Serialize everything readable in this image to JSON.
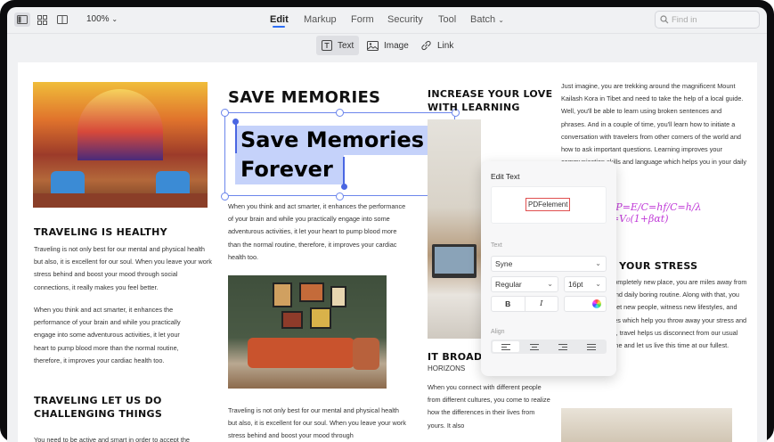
{
  "toolbar": {
    "zoom": "100%",
    "menus": [
      "Edit",
      "Markup",
      "Form",
      "Security",
      "Tool",
      "Batch"
    ],
    "search_placeholder": "Find in"
  },
  "subtoolbar": {
    "text": "Text",
    "image": "Image",
    "link": "Link"
  },
  "document": {
    "col1": {
      "h_travel": "TRAVELING IS HEALTHY",
      "p1": "Traveling is not only best for our mental and physical health but also, it is excellent for our soul. When you leave your work stress behind and boost your mood through social connections, it really makes you feel better.",
      "p2": "When you think and act smarter, it enhances the performance of your brain and while you practically engage into some adventurous activities, it let your heart to pump blood more than the normal routine, therefore, it improves your cardiac health too.",
      "h_challenge": "TRAVELING LET US DO CHALLENGING THINGS",
      "p3": "You need to be active and smart in order to accept the"
    },
    "col2": {
      "h_save": "SAVE MEMORIES",
      "selected_line1": "Save Memories",
      "selected_line2": "Forever",
      "p1": "When you think and act smarter, it enhances the performance of your brain and while you practically engage into some adventurous activities, it let your heart to pump blood more than the normal routine, therefore, it improves your cardiac health too.",
      "p2": "Traveling is not only best for our mental and physical health but also, it is excellent for our soul. When you leave your work stress behind and boost your mood through"
    },
    "col3": {
      "h_increase": "INCREASE YOUR LOVE WITH LEARNING",
      "h_broadens": "IT BROADENS YOUR",
      "h_horizons": "HORIZONS",
      "p1": "When you connect with different people from different cultures, you come to realize how the differences in their lives from yours. It also"
    },
    "col4": {
      "p1": "Just imagine, you are trekking around the magnificent Mount Kailash Kora in Tibet and need to take the help of a local guide. Well, you'll be able to learn using broken sentences and phrases. And in a couple of time, you'll learn how to initiate a conversation with travelers from other corners of the world and how to ask important questions. Learning improves your communication skills and language which helps you in your daily life too.",
      "formula": "f=P=E/C=hf/C=h/λ  V=V₀(1+βαt)",
      "h_stress": "RELIEVES YOUR STRESS",
      "p2": "When you visit a completely new place, you are miles away from your stressful life and daily boring routine. Along with that, you get a chance to meet new people, witness new lifestyles, and explore new cultures which help you throw away your stress and feel relaxed. In fact, travel helps us disconnect from our usual routine for some time and let us live this time at our fullest."
    }
  },
  "edit_panel": {
    "title": "Edit Text",
    "preview_text": "PDFelement",
    "text_label": "Text",
    "font": "Syne",
    "style": "Regular",
    "size": "16pt",
    "bold": "B",
    "italic": "I",
    "align_label": "Align"
  }
}
